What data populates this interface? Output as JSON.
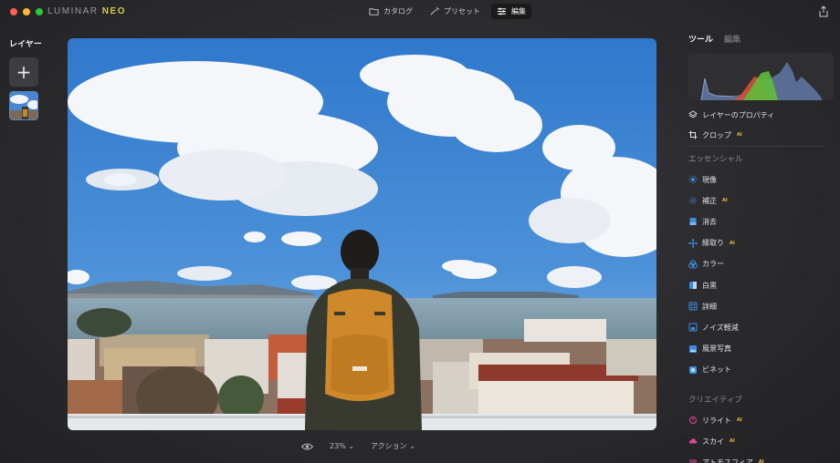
{
  "app": {
    "logo_prefix": "LUMINAR",
    "logo_suffix": "NEO"
  },
  "topnav": {
    "catalog": "カタログ",
    "presets": "プリセット",
    "edit": "編集"
  },
  "left_panel": {
    "title": "レイヤー",
    "add_label": "+"
  },
  "bottombar": {
    "zoom": "23%",
    "actions": "アクション"
  },
  "right_panel": {
    "tab_tools": "ツール",
    "tab_edits": "編集",
    "layer_properties": "レイヤーのプロパティ",
    "crop": "クロップ",
    "section_essentials": "エッセンシャル",
    "section_creative": "クリエイティブ",
    "ai_badge": "AI",
    "tools": [
      {
        "label": "現像",
        "icon": "sun-icon",
        "ai": false
      },
      {
        "label": "補正",
        "icon": "sparkle-icon",
        "ai": true
      },
      {
        "label": "消去",
        "icon": "eraser-icon",
        "ai": false
      },
      {
        "label": "縁取り",
        "icon": "structure-icon",
        "ai": true
      },
      {
        "label": "カラー",
        "icon": "color-circles-icon",
        "ai": false
      },
      {
        "label": "白黒",
        "icon": "bw-icon",
        "ai": false
      },
      {
        "label": "詳細",
        "icon": "details-icon",
        "ai": false
      },
      {
        "label": "ノイズ軽減",
        "icon": "noise-icon",
        "ai": false
      },
      {
        "label": "風景写真",
        "icon": "landscape-icon",
        "ai": false
      },
      {
        "label": "ビネット",
        "icon": "vignette-icon",
        "ai": false
      }
    ],
    "creative_tools": [
      {
        "label": "リライト",
        "icon": "relight-icon",
        "ai": true
      },
      {
        "label": "スカイ",
        "icon": "cloud-icon",
        "ai": true
      },
      {
        "label": "アトモスフィア",
        "icon": "atmosphere-icon",
        "ai": true
      }
    ]
  },
  "colors": {
    "accent_blue": "#3b8fe0",
    "ai_badge": "#e7b93c",
    "creative_pink": "#e0459a"
  }
}
